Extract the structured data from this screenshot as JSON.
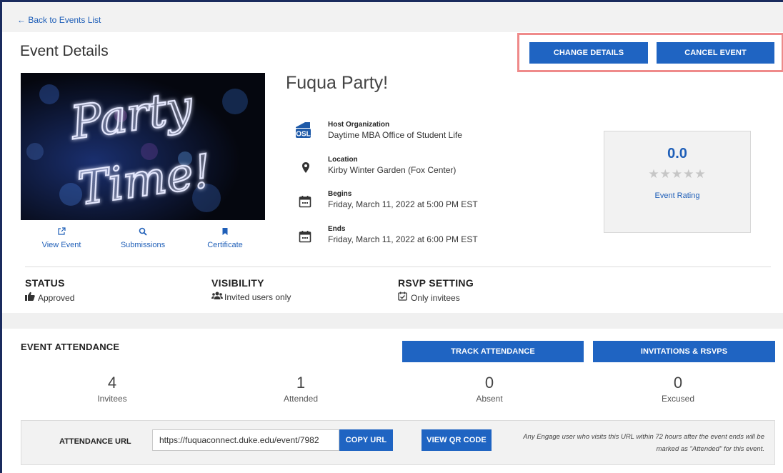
{
  "topbar": {
    "back_label": "← Back to Events List"
  },
  "page": {
    "title": "Event Details"
  },
  "actions": {
    "change_label": "CHANGE DETAILS",
    "cancel_label": "CANCEL EVENT"
  },
  "event": {
    "name": "Fuqua Party!",
    "image_text_line1": "Party",
    "image_text_line2": "Time!",
    "image_links": [
      {
        "label": "View Event",
        "icon": "external-link-icon"
      },
      {
        "label": "Submissions",
        "icon": "search-icon"
      },
      {
        "label": "Certificate",
        "icon": "bookmark-icon"
      }
    ],
    "details": [
      {
        "label": "Host Organization",
        "value": "Daytime MBA Office of Student Life",
        "icon": "osl-logo-icon"
      },
      {
        "label": "Location",
        "value": "Kirby Winter Garden (Fox Center)",
        "icon": "map-pin-icon"
      },
      {
        "label": "Begins",
        "value": "Friday, March 11, 2022 at 5:00 PM EST",
        "icon": "calendar-icon"
      },
      {
        "label": "Ends",
        "value": "Friday, March 11, 2022 at 6:00 PM EST",
        "icon": "calendar-icon"
      }
    ],
    "osl_badge": "OSL"
  },
  "rating": {
    "value": "0.0",
    "stars": "★★★★★",
    "stars_filled": 0,
    "stars_total": 5,
    "label": "Event Rating"
  },
  "settings": {
    "status": {
      "heading": "STATUS",
      "value": "Approved",
      "icon": "thumbs-up-icon"
    },
    "visibility": {
      "heading": "VISIBILITY",
      "value": "Invited users only",
      "icon": "users-icon"
    },
    "rsvp": {
      "heading": "RSVP SETTING",
      "value": "Only invitees",
      "icon": "calendar-check-icon"
    }
  },
  "attendance": {
    "title": "EVENT ATTENDANCE",
    "track_label": "TRACK ATTENDANCE",
    "invitations_label": "INVITATIONS & RSVPS",
    "counts": [
      {
        "number": "4",
        "label": "Invitees"
      },
      {
        "number": "1",
        "label": "Attended"
      },
      {
        "number": "0",
        "label": "Absent"
      },
      {
        "number": "0",
        "label": "Excused"
      }
    ],
    "url_label": "ATTENDANCE URL",
    "url_value": "https://fuquaconnect.duke.edu/event/7982",
    "copy_label": "COPY URL",
    "qr_label": "VIEW QR CODE",
    "note": "Any Engage user who visits this URL within 72 hours after the event ends will be marked as \"Attended\" for this event."
  },
  "colors": {
    "primary": "#1f64c2",
    "link": "#1f5fb8",
    "highlight": "#ef8a8a",
    "neon": "#e6e9ff"
  }
}
